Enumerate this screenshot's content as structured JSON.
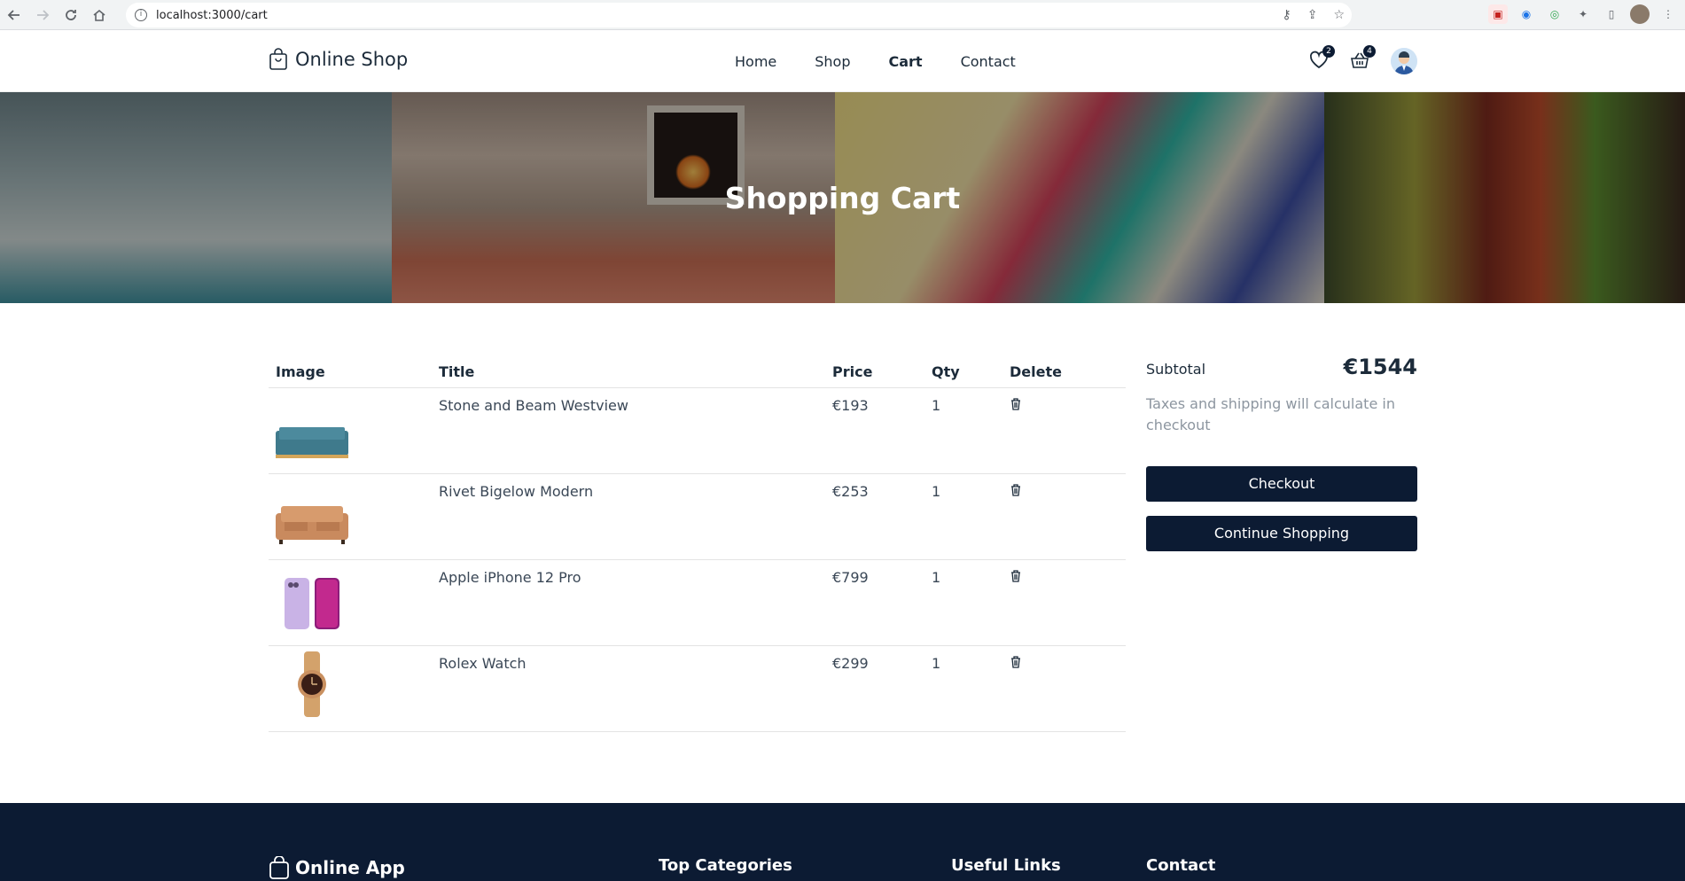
{
  "browser": {
    "url": "localhost:3000/cart",
    "back_icon": "arrow-left-icon",
    "forward_icon": "arrow-right-icon",
    "reload_icon": "reload-icon",
    "home_icon": "home-icon"
  },
  "header": {
    "logo_text": "Online Shop",
    "nav": [
      "Home",
      "Shop",
      "Cart",
      "Contact"
    ],
    "active_nav": "Cart",
    "wishlist_count": "2",
    "cart_count": "4"
  },
  "hero": {
    "title": "Shopping Cart"
  },
  "cart": {
    "headers": {
      "image": "Image",
      "title": "Title",
      "price": "Price",
      "qty": "Qty",
      "delete": "Delete"
    },
    "items": [
      {
        "title": "Stone and Beam Westview",
        "price": "€193",
        "qty": "1",
        "image": "teal-sofa"
      },
      {
        "title": "Rivet Bigelow Modern",
        "price": "€253",
        "qty": "1",
        "image": "tan-sofa"
      },
      {
        "title": "Apple iPhone 12 Pro",
        "price": "€799",
        "qty": "1",
        "image": "purple-phones"
      },
      {
        "title": "Rolex Watch",
        "price": "€299",
        "qty": "1",
        "image": "gold-watch"
      }
    ]
  },
  "summary": {
    "subtotal_label": "Subtotal",
    "subtotal_value": "€1544",
    "tax_note": "Taxes and shipping will calculate in checkout",
    "checkout_label": "Checkout",
    "continue_label": "Continue Shopping"
  },
  "footer": {
    "logo_text": "Online App",
    "col1": "Top Categories",
    "col2": "Useful Links",
    "col3": "Contact"
  },
  "colors": {
    "primary": "#0c1b33",
    "text": "#1c2b3a",
    "muted": "#8d96a0"
  }
}
